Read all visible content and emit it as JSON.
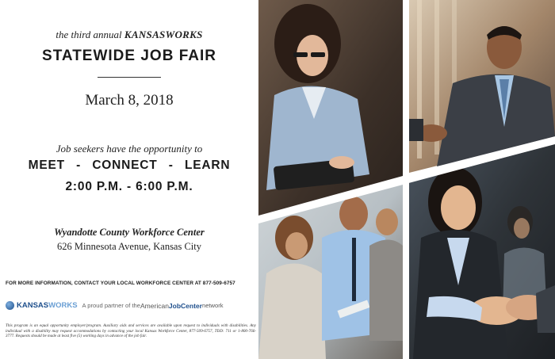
{
  "flyer": {
    "subtitle_pre": "the third annual ",
    "subtitle_brand": "KANSASWORKS",
    "title": "STATEWIDE JOB FAIR",
    "date": "March 8, 2018",
    "seekers_line": "Job seekers have the opportunity to",
    "meet_connect_learn": "MEET  -  CONNECT  -  LEARN",
    "time": "2:00 P.M. - 6:00 P.M.",
    "venue_name": "Wyandotte County Workforce Center",
    "venue_address": "626 Minnesota Avenue, Kansas City",
    "more_info": "FOR MORE INFORMATION, CONTACT YOUR LOCAL WORKFORCE CENTER AT 877-509-6757",
    "logo_kansas": "KANSAS",
    "logo_works": "WORKS",
    "partner_text": "A proud partner of the ",
    "ajc_american": "American",
    "ajc_jobcenter": "JobCenter",
    "ajc_network": "network",
    "disclaimer": "This program is an equal opportunity employer/program. Auxiliary aids and services are available upon request to individuals with disabilities. Any individual with a disability may request accommodations by contacting your local Kansas Workforce Center, 877-509-6757, TDD: 711 or 1-800-766-3777. Requests should be made at least five (5) working days in advance of the job fair."
  },
  "photos": [
    {
      "icon": "woman-with-tablet-photo"
    },
    {
      "icon": "man-shaking-hand-photo"
    },
    {
      "icon": "job-seekers-seated-photo"
    },
    {
      "icon": "smiling-woman-handshake-photo"
    }
  ],
  "colors": {
    "brand_blue": "#1e4f8c",
    "brand_light_blue": "#6a9fd4",
    "text": "#222222",
    "divider": "#ffffff"
  }
}
